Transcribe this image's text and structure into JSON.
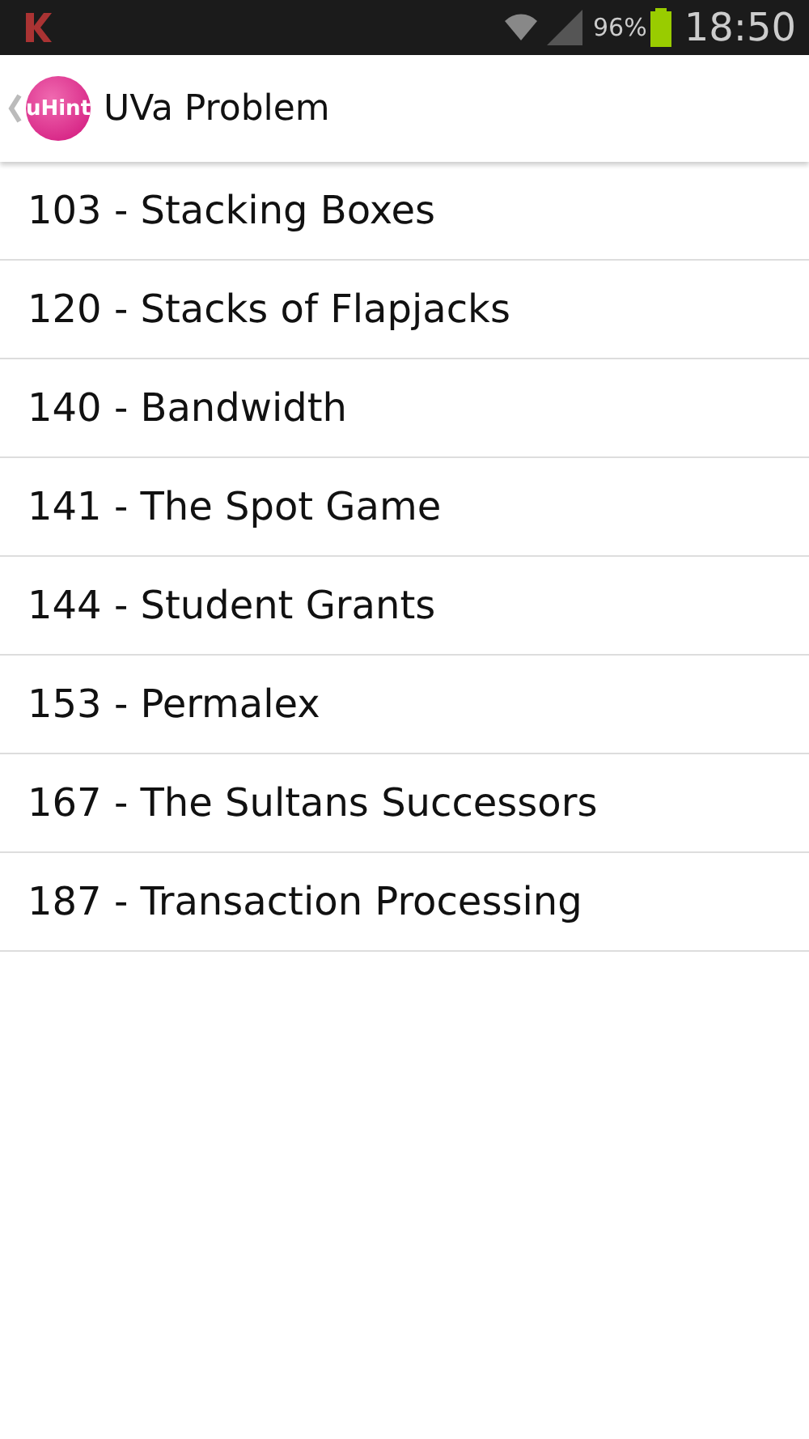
{
  "status_bar": {
    "battery": "96%",
    "time": "18:50"
  },
  "action_bar": {
    "logo_text": "uHint",
    "title": "UVa Problem"
  },
  "problems": [
    {
      "label": "103 - Stacking Boxes"
    },
    {
      "label": "120 - Stacks of Flapjacks"
    },
    {
      "label": "140 - Bandwidth"
    },
    {
      "label": "141 - The Spot Game"
    },
    {
      "label": "144 - Student Grants"
    },
    {
      "label": "153 - Permalex"
    },
    {
      "label": "167 - The Sultans Successors"
    },
    {
      "label": "187 - Transaction Processing"
    }
  ]
}
